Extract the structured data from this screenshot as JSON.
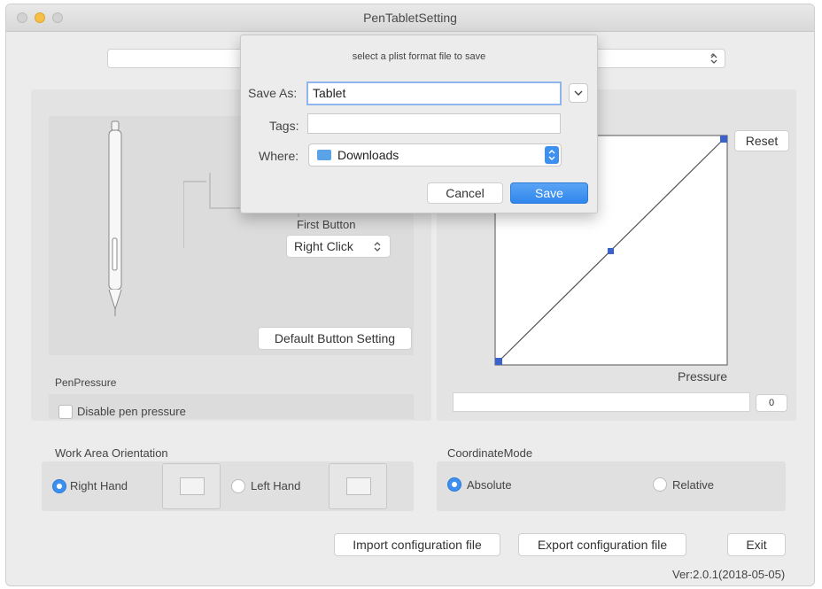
{
  "window": {
    "title": "PenTabletSetting"
  },
  "dialog": {
    "message": "select a plist format file to save",
    "save_as_label": "Save As:",
    "save_as_value": "Tablet",
    "tags_label": "Tags:",
    "tags_value": "",
    "where_label": "Where:",
    "where_value": "Downloads",
    "cancel_label": "Cancel",
    "save_label": "Save"
  },
  "pen_panel": {
    "first_button_label": "First Button",
    "first_button_value": "Right Click",
    "default_button_setting": "Default  Button Setting"
  },
  "pressure": {
    "section_label": "PenPressure",
    "disable_label": "Disable pen pressure",
    "disable_checked": false,
    "reset_label": "Reset",
    "axis_label": "Pressure",
    "value": "0"
  },
  "work_area": {
    "label": "Work Area Orientation",
    "right_hand_label": "Right Hand",
    "left_hand_label": "Left Hand",
    "selected": "Right Hand"
  },
  "coordinate": {
    "label": "CoordinateMode",
    "absolute_label": "Absolute",
    "relative_label": "Relative",
    "selected": "Absolute"
  },
  "footer": {
    "import_label": "Import configuration file",
    "export_label": "Export configuration file",
    "exit_label": "Exit",
    "version": "Ver:2.0.1(2018-05-05)"
  },
  "colors": {
    "accent": "#3d8ff0",
    "curve_handle": "#3a62c8"
  }
}
